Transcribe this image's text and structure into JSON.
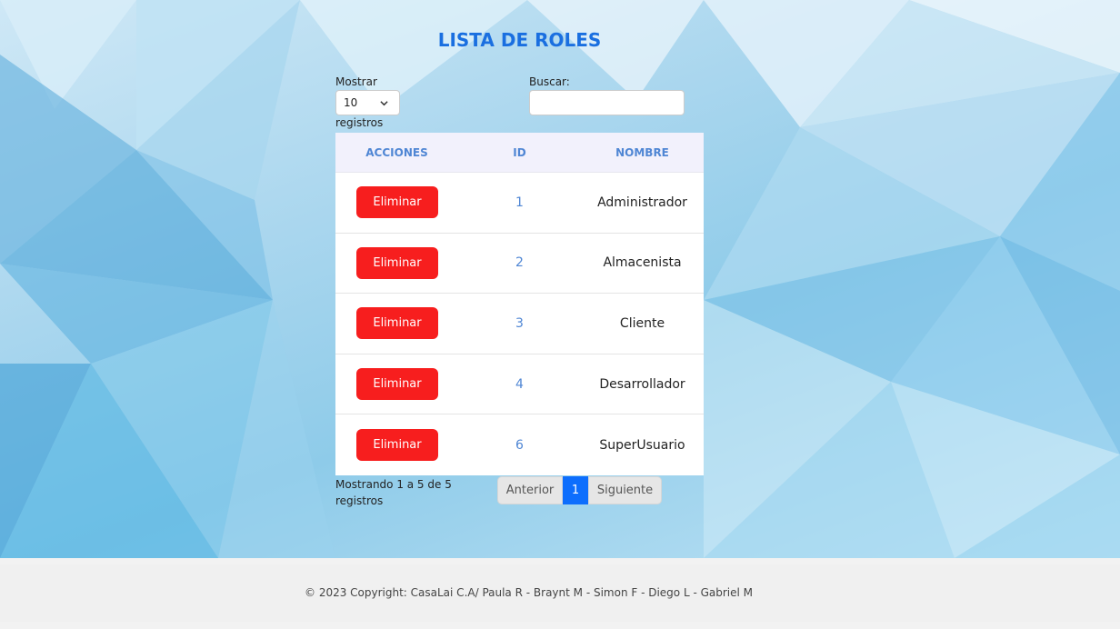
{
  "page": {
    "title": "LISTA DE ROLES"
  },
  "controls": {
    "show_label": "Mostrar",
    "show_value": "10",
    "records_label": "registros",
    "search_label": "Buscar:",
    "search_value": ""
  },
  "table": {
    "headers": [
      "ACCIONES",
      "ID",
      "NOMBRE"
    ],
    "rows": [
      {
        "action": "Eliminar",
        "id": "1",
        "name": "Administrador"
      },
      {
        "action": "Eliminar",
        "id": "2",
        "name": "Almacenista"
      },
      {
        "action": "Eliminar",
        "id": "3",
        "name": "Cliente"
      },
      {
        "action": "Eliminar",
        "id": "4",
        "name": "Desarrollador"
      },
      {
        "action": "Eliminar",
        "id": "6",
        "name": "SuperUsuario"
      }
    ]
  },
  "pagination": {
    "info": "Mostrando 1 a 5 de 5 registros",
    "prev": "Anterior",
    "current": "1",
    "next": "Siguiente"
  },
  "footer": {
    "text": "© 2023 Copyright: CasaLai C.A/ Paula R - Braynt M - Simon F - Diego L - Gabriel M"
  },
  "colors": {
    "title": "#1a6fe0",
    "delete_button": "#f71e1e",
    "header_text": "#4f86d4",
    "active_page": "#0d6efd"
  }
}
